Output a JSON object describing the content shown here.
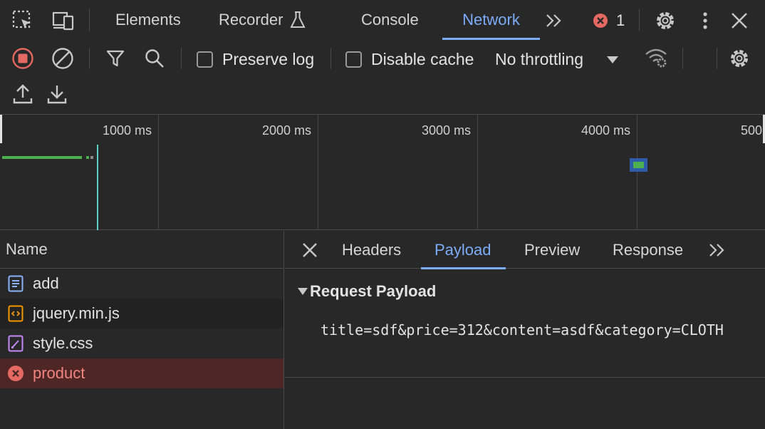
{
  "tabs": [
    "Elements",
    "Recorder",
    "Console",
    "Network"
  ],
  "error_count": "1",
  "toolbar": {
    "preserve_log": "Preserve log",
    "disable_cache": "Disable cache",
    "throttling": "No throttling"
  },
  "timeline": {
    "ticks": [
      "1000 ms",
      "2000 ms",
      "3000 ms",
      "4000 ms",
      "500"
    ]
  },
  "requests": {
    "header": "Name",
    "items": [
      {
        "name": "add",
        "type": "document"
      },
      {
        "name": "jquery.min.js",
        "type": "script"
      },
      {
        "name": "style.css",
        "type": "stylesheet"
      },
      {
        "name": "product",
        "type": "error"
      }
    ]
  },
  "detail": {
    "tabs": [
      "Headers",
      "Payload",
      "Preview",
      "Response"
    ],
    "active_tab": "Payload",
    "section_title": "Request Payload",
    "payload": "title=sdf&price=312&content=asdf&category=CLOTH"
  },
  "colors": {
    "accent": "#7cacf8",
    "error": "#f2857f",
    "record": "#e46962",
    "waterfall_green": "#4caf50"
  }
}
